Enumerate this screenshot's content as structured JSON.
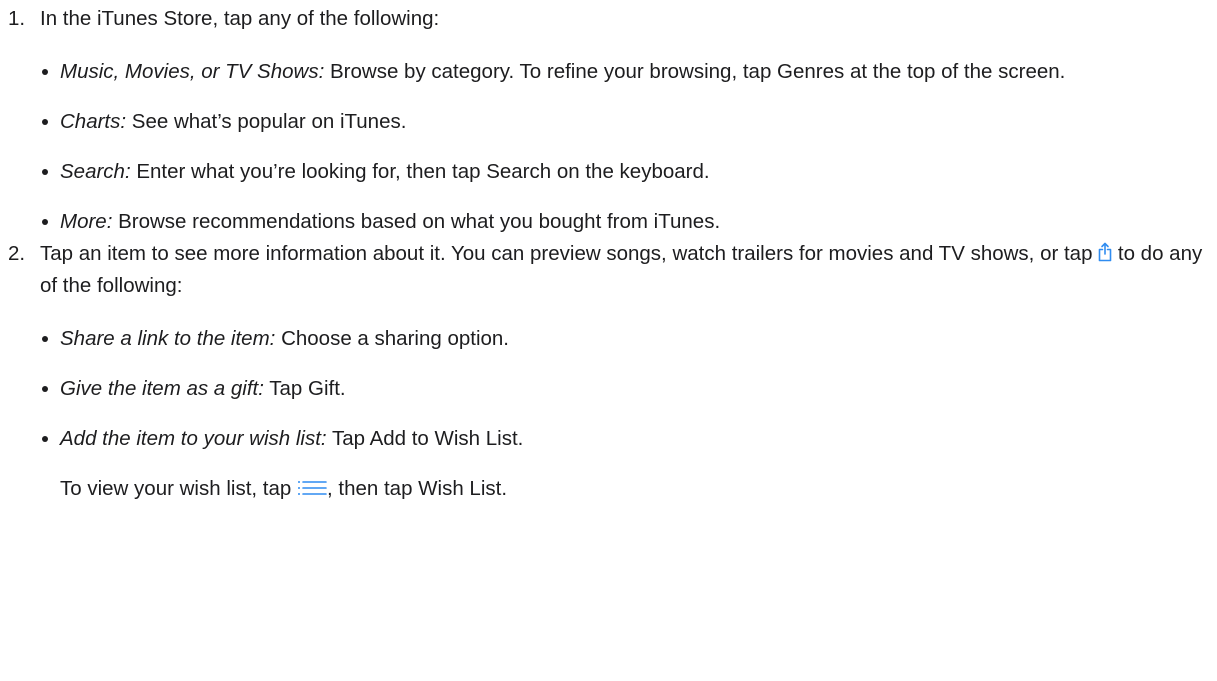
{
  "steps": [
    {
      "number": "1.",
      "text": "In the iTunes Store, tap any of the following:",
      "items": [
        {
          "term": "Music, Movies, or TV Shows:",
          "text": " Browse by category. To refine your browsing, tap Genres at the top of the screen."
        },
        {
          "term": "Charts:",
          "text": " See what’s popular on iTunes."
        },
        {
          "term": "Search:",
          "text": " Enter what you’re looking for, then tap Search on the keyboard."
        },
        {
          "term": "More:",
          "text": " Browse recommendations based on what you bought from iTunes."
        }
      ]
    },
    {
      "number": "2.",
      "text_before_icon": "Tap an item to see more information about it. You can preview songs, watch trailers for movies and TV shows, or tap ",
      "icon": "share-icon",
      "text_after_icon": " to do any of the following:",
      "items": [
        {
          "term": "Share a link to the item:",
          "text": " Choose a sharing option."
        },
        {
          "term": "Give the item as a gift:",
          "text": " Tap Gift."
        },
        {
          "term": "Add the item to your wish list:",
          "text": " Tap Add to Wish List."
        }
      ],
      "note": {
        "text_before_icon": "To view your wish list, tap ",
        "icon": "list-icon",
        "text_after_icon": ", then tap Wish List."
      }
    }
  ],
  "colors": {
    "text": "#1d1d1f",
    "icon_accent": "#2f8cf0"
  }
}
